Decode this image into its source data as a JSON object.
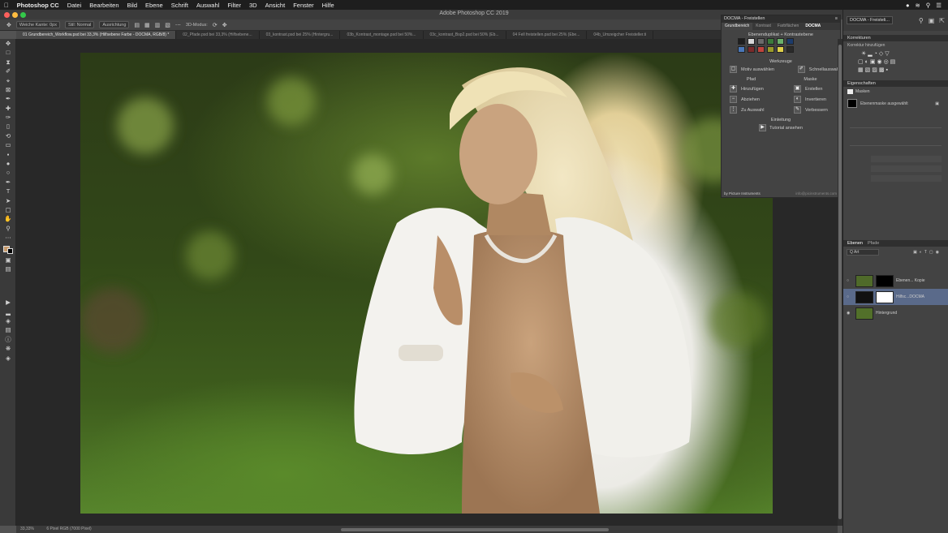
{
  "menubar": {
    "apple_icon": "apple-icon",
    "items": [
      "Photoshop CC",
      "Datei",
      "Bearbeiten",
      "Bild",
      "Ebene",
      "Schrift",
      "Auswahl",
      "Filter",
      "3D",
      "Ansicht",
      "Fenster",
      "Hilfe"
    ]
  },
  "window": {
    "title": "Adobe Photoshop CC 2019"
  },
  "options": {
    "chip1": "Weiche Kante: 0px",
    "chip2": "Stil: Normal",
    "chip3": "Ausrichtung",
    "label_3d": "3D-Modus:"
  },
  "tabs": [
    {
      "label": "01 Grundbereich_Workflow.psd bei 33,3% (Hilfsebene Farbe - DOCMA, RGB/8) *",
      "active": true
    },
    {
      "label": "02_Pfade.psd bei 33,3% (Hilfsebene...",
      "active": false
    },
    {
      "label": "03_kontrast.psd bei 25% (Hintergru...",
      "active": false
    },
    {
      "label": "03b_Kontrast_montage.psd bei 50%...",
      "active": false
    },
    {
      "label": "03c_kontrast_Bsp2.psd bei 50% (Eb...",
      "active": false
    },
    {
      "label": "04 Fell freistellen.psd bei 25% (Ebe...",
      "active": false
    },
    {
      "label": "04b_Umzeigcher Freisteller.ti",
      "active": false
    }
  ],
  "docma": {
    "panel_title": "DOCMA - Freistellen",
    "tabs": [
      "Grundbereich",
      "Kontrast",
      "Farbflächen",
      "DOCMA"
    ],
    "section_duplicate": "Ebenenduplikat + Kontrastebene",
    "section_tools": "Werkzeuge",
    "motiv_label": "Motiv auswählen",
    "schnell_label": "Schnellauswahl",
    "pfad_header": "Pfad",
    "maske_header": "Maske",
    "pfad_items": [
      "Hinzufügen",
      "Abziehen",
      "Zu Auswahl"
    ],
    "maske_items": [
      "Erstellen",
      "Invertieren",
      "Verbessern"
    ],
    "section_intro": "Einleitung",
    "tutorial_label": "Tutorial ansehen",
    "footer": "by Picture Instruments",
    "footer_right": "info@picinstruments.com",
    "swatch_colors": [
      "#1e1e1e",
      "#d8d8d8",
      "#6a6a6a",
      "#3b7a3b",
      "#6ab06a",
      "#1c3b6b",
      "#4a77b8",
      "#7a2a2a",
      "#c0443c",
      "#9a9a2a",
      "#e0d04a",
      "#2a2a2a"
    ]
  },
  "right_column": {
    "plugin_tab": "DOCMA - Freisteli...",
    "korrekturen_title": "Korrekturen",
    "korrekturen_sub": "Korrektur hinzufügen",
    "eigenschaften_title": "Eigenschaften",
    "eigenschaften_masken": "Masken",
    "mask_label": "Ebenenmaske ausgewählt",
    "ebenen_tab": "Ebenen",
    "pfade_tab": "Pfade",
    "kind_filter": "Q Art",
    "layers": [
      {
        "name": "Ebenen... Kopie",
        "visible": false,
        "thumb": "#4f6a2a",
        "mask": "#000000",
        "selected": false
      },
      {
        "name": "Hilfsc...DOCMA",
        "visible": false,
        "thumb": "#111111",
        "mask": "#ffffff",
        "selected": true
      },
      {
        "name": "Hintergrund",
        "visible": true,
        "thumb": "#52702a",
        "mask": "",
        "selected": false
      }
    ]
  },
  "status": {
    "zoom": "33,33%",
    "doc": "6 Pixel RGB (7000 Pixel)"
  }
}
